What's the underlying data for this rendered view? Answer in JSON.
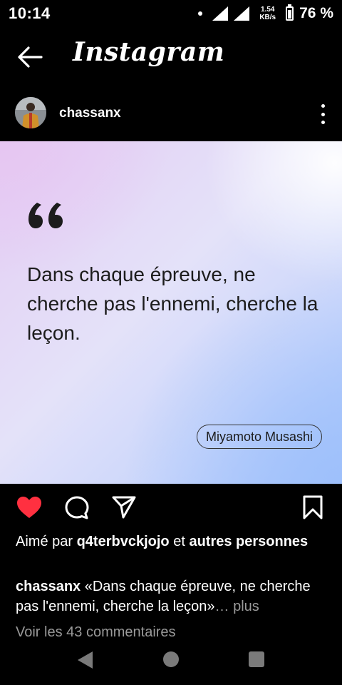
{
  "status_bar": {
    "time": "10:14",
    "net_speed_value": "1.54",
    "net_speed_unit": "KB/s",
    "battery": "76 %",
    "battery_level": 0.76
  },
  "header": {
    "title": "Instagram"
  },
  "post": {
    "username": "chassanx",
    "image": {
      "quote": "Dans chaque épreuve, ne cherche pas l'ennemi, cherche la leçon.",
      "author": "Miyamoto Musashi"
    },
    "likes": {
      "prefix": "Aimé par",
      "user": "q4terbvckjojo",
      "connector": "et",
      "others": "autres personnes"
    },
    "caption": {
      "username": "chassanx",
      "text": "«Dans chaque épreuve, ne cherche pas l'ennemi, cherche la leçon»",
      "more": "… plus"
    },
    "comments_link": "Voir les 43 commentaires"
  },
  "colors": {
    "like": "#ff3040",
    "background": "#000000"
  },
  "icons": {
    "back": "arrow-left",
    "more": "vertical-dots",
    "like": "heart-filled",
    "comment": "speech-bubble",
    "share": "paper-plane",
    "save": "bookmark"
  }
}
